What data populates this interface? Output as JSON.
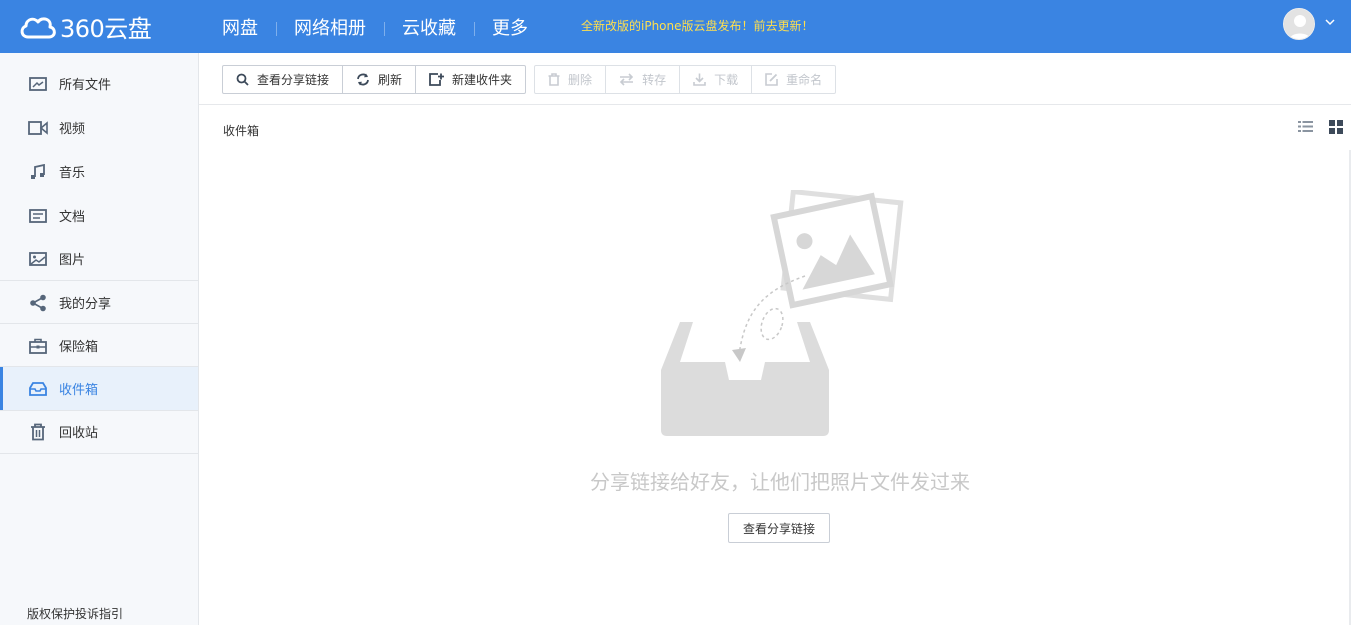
{
  "header": {
    "logo_text": "360云盘",
    "nav": [
      "网盘",
      "网络相册",
      "云收藏",
      "更多"
    ],
    "notice": "全新改版的iPhone版云盘发布！前去更新！"
  },
  "sidebar": {
    "items": [
      {
        "label": "所有文件",
        "icon": "all-files-icon"
      },
      {
        "label": "视频",
        "icon": "video-icon"
      },
      {
        "label": "音乐",
        "icon": "music-icon"
      },
      {
        "label": "文档",
        "icon": "document-icon"
      },
      {
        "label": "图片",
        "icon": "picture-icon"
      },
      {
        "label": "我的分享",
        "icon": "share-icon"
      },
      {
        "label": "保险箱",
        "icon": "safe-icon"
      },
      {
        "label": "收件箱",
        "icon": "inbox-icon",
        "active": true
      },
      {
        "label": "回收站",
        "icon": "trash-icon"
      }
    ],
    "footer": "版权保护投诉指引"
  },
  "toolbar": {
    "view_share_link": "查看分享链接",
    "refresh": "刷新",
    "new_folder": "新建收件夹",
    "delete": "删除",
    "transfer": "转存",
    "download": "下载",
    "rename": "重命名"
  },
  "breadcrumb": "收件箱",
  "empty_state": {
    "message": "分享链接给好友，让他们把照片文件发过来",
    "button": "查看分享链接"
  },
  "colors": {
    "header_bg": "#3a84e2",
    "notice": "#ffdf4d",
    "active": "#3a84e2"
  }
}
